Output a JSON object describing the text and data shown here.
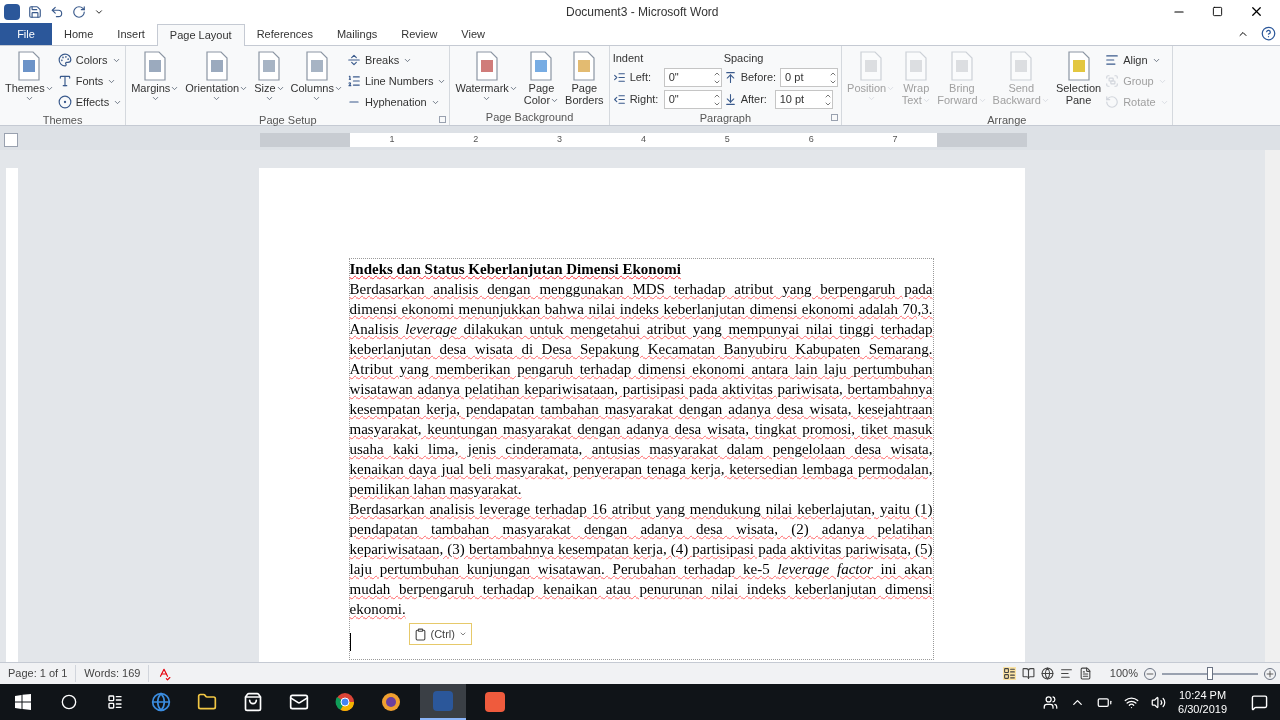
{
  "window": {
    "title": "Document3  -  Microsoft Word"
  },
  "tabs": [
    {
      "label": "File",
      "kind": "file",
      "selected": false
    },
    {
      "label": "Home",
      "kind": "tab",
      "selected": false
    },
    {
      "label": "Insert",
      "kind": "tab",
      "selected": false
    },
    {
      "label": "Page Layout",
      "kind": "tab",
      "selected": true
    },
    {
      "label": "References",
      "kind": "tab",
      "selected": false
    },
    {
      "label": "Mailings",
      "kind": "tab",
      "selected": false
    },
    {
      "label": "Review",
      "kind": "tab",
      "selected": false
    },
    {
      "label": "View",
      "kind": "tab",
      "selected": false
    }
  ],
  "ribbon_groups": [
    {
      "label": "Themes",
      "dialog_launcher": false,
      "columns": [
        [
          {
            "kind": "large",
            "lines": [
              "Themes"
            ],
            "dropdown": true,
            "disabled": false
          }
        ],
        [
          {
            "kind": "small",
            "label": "Colors",
            "dropdown": true,
            "disabled": false
          },
          {
            "kind": "small",
            "label": "Fonts",
            "dropdown": true,
            "disabled": false
          },
          {
            "kind": "small",
            "label": "Effects",
            "dropdown": true,
            "disabled": false
          }
        ]
      ]
    },
    {
      "label": "Page Setup",
      "dialog_launcher": true,
      "columns": [
        [
          {
            "kind": "large",
            "lines": [
              "Margins"
            ],
            "dropdown": true,
            "disabled": false
          }
        ],
        [
          {
            "kind": "large",
            "lines": [
              "Orientation"
            ],
            "dropdown": true,
            "disabled": false
          }
        ],
        [
          {
            "kind": "large",
            "lines": [
              "Size"
            ],
            "dropdown": true,
            "disabled": false
          }
        ],
        [
          {
            "kind": "large",
            "lines": [
              "Columns"
            ],
            "dropdown": true,
            "disabled": false
          }
        ],
        [
          {
            "kind": "small",
            "label": "Breaks",
            "dropdown": true,
            "disabled": false
          },
          {
            "kind": "small",
            "label": "Line Numbers",
            "dropdown": true,
            "disabled": false
          },
          {
            "kind": "small",
            "label": "Hyphenation",
            "dropdown": true,
            "disabled": false
          }
        ]
      ]
    },
    {
      "label": "Page Background",
      "dialog_launcher": false,
      "columns": [
        [
          {
            "kind": "large",
            "lines": [
              "Watermark"
            ],
            "dropdown": true,
            "disabled": false
          }
        ],
        [
          {
            "kind": "large",
            "lines": [
              "Page",
              "Color"
            ],
            "dropdown": true,
            "disabled": false
          }
        ],
        [
          {
            "kind": "large",
            "lines": [
              "Page",
              "Borders"
            ],
            "dropdown": false,
            "disabled": false
          }
        ]
      ]
    },
    {
      "label": "Paragraph",
      "dialog_launcher": true,
      "columns": [
        [
          {
            "kind": "heading",
            "label": "Indent"
          },
          {
            "kind": "field",
            "label": "Left:",
            "value": "0\""
          },
          {
            "kind": "field",
            "label": "Right:",
            "value": "0\""
          }
        ],
        [
          {
            "kind": "heading",
            "label": "Spacing"
          },
          {
            "kind": "field",
            "label": "Before:",
            "value": "0 pt"
          },
          {
            "kind": "field",
            "label": "After:",
            "value": "10 pt"
          }
        ]
      ]
    },
    {
      "label": "Arrange",
      "dialog_launcher": false,
      "columns": [
        [
          {
            "kind": "large",
            "lines": [
              "Position"
            ],
            "dropdown": true,
            "disabled": true
          }
        ],
        [
          {
            "kind": "large",
            "lines": [
              "Wrap",
              "Text"
            ],
            "dropdown": true,
            "disabled": true
          }
        ],
        [
          {
            "kind": "large",
            "lines": [
              "Bring",
              "Forward"
            ],
            "dropdown": true,
            "disabled": true
          }
        ],
        [
          {
            "kind": "large",
            "lines": [
              "Send",
              "Backward"
            ],
            "dropdown": true,
            "disabled": true
          }
        ],
        [
          {
            "kind": "large",
            "lines": [
              "Selection",
              "Pane"
            ],
            "dropdown": false,
            "disabled": false
          }
        ],
        [
          {
            "kind": "small",
            "label": "Align",
            "dropdown": true,
            "disabled": false
          },
          {
            "kind": "small",
            "label": "Group",
            "dropdown": true,
            "disabled": true
          },
          {
            "kind": "small",
            "label": "Rotate",
            "dropdown": true,
            "disabled": true
          }
        ]
      ]
    }
  ],
  "ruler": {
    "numbers": [
      "1",
      "2",
      "3",
      "4",
      "5",
      "6",
      "7"
    ]
  },
  "document": {
    "heading": "Indeks dan Status Keberlanjutan Dimensi Ekonomi",
    "paragraphs": [
      "Berdasarkan analisis dengan menggunakan MDS terhadap atribut yang berpengaruh pada dimensi ekonomi menunjukkan bahwa nilai indeks keberlanjutan dimensi ekonomi adalah 70,3. Analisis *leverage* dilakukan untuk mengetahui atribut yang mempunyai nilai tinggi terhadap keberlanjutan desa wisata di Desa Sepakung Kecamatan Banyubiru Kabupaten Semarang. Atribut yang memberikan pengaruh terhadap dimensi ekonomi antara lain laju pertumbuhan wisatawan adanya pelatihan kepariwisataan, partisipasi pada aktivitas pariwisata, bertambahnya kesempatan kerja, pendapatan tambahan masyarakat dengan adanya desa wisata, kesejahtraan masyarakat, keuntungan masyarakat dengan adanya desa wisata, tingkat promosi, tiket masuk usaha kaki lima, jenis cinderamata, antusias masyarakat dalam pengelolaan desa wisata, kenaikan daya jual beli masyarakat, penyerapan tenaga kerja, ketersedian lembaga permodalan, pemilikan lahan masyarakat.",
      "Berdasarkan analisis leverage terhadap 16 atribut yang mendukung nilai keberlajutan, yaitu (1) pendapatan tambahan masyarakat dengan adanya desa wisata, (2) adanya pelatihan kepariwisataan, (3) bertambahnya kesempatan kerja, (4) partisipasi pada aktivitas pariwisata, (5) laju pertumbuhan kunjungan wisatawan. Perubahan terhadap ke-5 *leverage factor* ini akan mudah berpengaruh terhadap kenaikan atau penurunan nilai indeks keberlanjutan dimensi ekonomi."
    ],
    "paste_options": "(Ctrl)"
  },
  "status_bar": {
    "page": "Page: 1 of 1",
    "words": "Words: 169",
    "zoom": "100%",
    "zoom_slider": {
      "level": 0.5
    }
  },
  "taskbar": {
    "time": "10:24 PM",
    "date": "6/30/2019"
  }
}
